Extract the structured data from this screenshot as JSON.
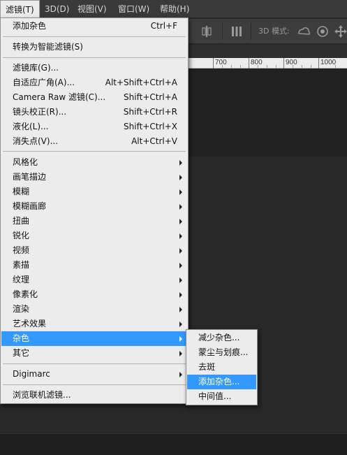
{
  "menubar": {
    "items": [
      {
        "label": "滤镜(T)"
      },
      {
        "label": "3D(D)"
      },
      {
        "label": "视图(V)"
      },
      {
        "label": "窗口(W)"
      },
      {
        "label": "帮助(H)"
      }
    ]
  },
  "options_bar": {
    "mode_label": "3D 模式:"
  },
  "ruler": {
    "labels": [
      "700",
      "800",
      "900",
      "1000"
    ]
  },
  "filter_menu": {
    "last_filter": {
      "label": "添加杂色",
      "shortcut": "Ctrl+F"
    },
    "convert_smart": {
      "label": "转换为智能滤镜(S)"
    },
    "gallery": {
      "label": "滤镜库(G)..."
    },
    "adaptive_wide": {
      "label": "自适应广角(A)...",
      "shortcut": "Alt+Shift+Ctrl+A"
    },
    "camera_raw": {
      "label": "Camera Raw 滤镜(C)...",
      "shortcut": "Shift+Ctrl+A"
    },
    "lens_correction": {
      "label": "镜头校正(R)...",
      "shortcut": "Shift+Ctrl+R"
    },
    "liquify": {
      "label": "液化(L)...",
      "shortcut": "Shift+Ctrl+X"
    },
    "vanishing_point": {
      "label": "消失点(V)...",
      "shortcut": "Alt+Ctrl+V"
    },
    "groups": [
      {
        "label": "风格化"
      },
      {
        "label": "画笔描边"
      },
      {
        "label": "模糊"
      },
      {
        "label": "模糊画廊"
      },
      {
        "label": "扭曲"
      },
      {
        "label": "锐化"
      },
      {
        "label": "视频"
      },
      {
        "label": "素描"
      },
      {
        "label": "纹理"
      },
      {
        "label": "像素化"
      },
      {
        "label": "渲染"
      },
      {
        "label": "艺术效果"
      },
      {
        "label": "杂色"
      },
      {
        "label": "其它"
      }
    ],
    "digimarc": {
      "label": "Digimarc"
    },
    "browse_online": {
      "label": "浏览联机滤镜..."
    }
  },
  "noise_submenu": {
    "items": [
      {
        "label": "减少杂色..."
      },
      {
        "label": "蒙尘与划痕..."
      },
      {
        "label": "去斑"
      },
      {
        "label": "添加杂色..."
      },
      {
        "label": "中间值..."
      }
    ]
  },
  "colors": {
    "highlight": "#3399ff",
    "menu_bg": "#ececec",
    "app_bg": "#282828"
  }
}
